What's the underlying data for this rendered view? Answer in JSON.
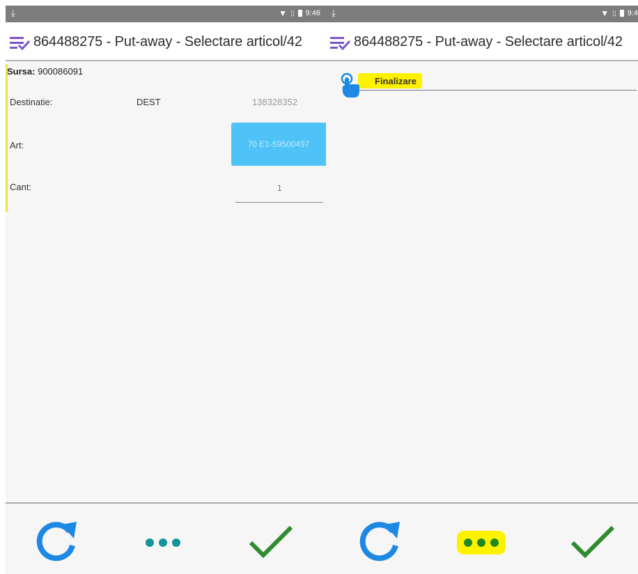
{
  "colors": {
    "status_bar": "#7c7c7c",
    "header_bg": "#ffffff",
    "menu_icon": "#7b54c8",
    "art_button": "#4fc3f7",
    "refresh_icon": "#1e88e5",
    "more_dots_left": "#13959a",
    "more_dots_right": "#1f8a1f",
    "check_icon": "#2e8b2e",
    "highlight": "#fff200",
    "accent_bar": "#f0e24a"
  },
  "left": {
    "status": {
      "download_icon": "download-arrow-icon",
      "time": "9:46"
    },
    "header": {
      "menu_icon": "list-check-icon",
      "title": "864488275 - Put-away - Selectare articol/42"
    },
    "form": {
      "sursa_label": "Sursa:",
      "sursa_value": "900086091",
      "destinatie_label": "Destinatie:",
      "destinatie_mid": "DEST",
      "destinatie_value": "138328352",
      "art_label": "Art:",
      "art_button_text": "70 E1-59500497",
      "cant_label": "Cant:",
      "cant_value": "1"
    },
    "bottom": {
      "refresh_icon": "refresh-icon",
      "more_icon": "more-dots-icon",
      "confirm_icon": "checkmark-icon"
    }
  },
  "right": {
    "status": {
      "download_icon": "download-arrow-icon",
      "time": "9:4"
    },
    "header": {
      "menu_icon": "list-check-icon",
      "title": "864488275 - Put-away - Selectare articol/42"
    },
    "finalizare_label": "Finalizare",
    "bottom": {
      "refresh_icon": "refresh-icon",
      "more_icon": "more-dots-icon",
      "confirm_icon": "checkmark-icon"
    }
  }
}
